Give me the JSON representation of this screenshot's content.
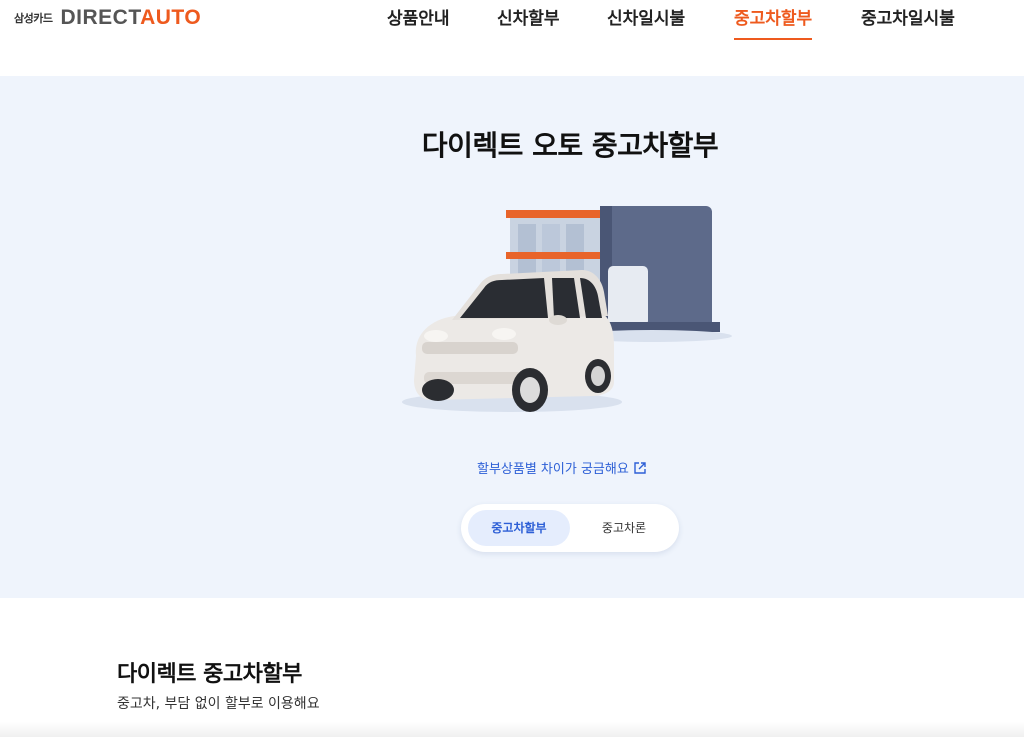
{
  "header": {
    "brand_small": "삼성카드",
    "brand_direct": "DIRECT",
    "brand_auto": "AUTO",
    "nav": [
      {
        "label": "상품안내"
      },
      {
        "label": "신차할부"
      },
      {
        "label": "신차일시불"
      },
      {
        "label": "중고차할부",
        "active": true
      },
      {
        "label": "중고차일시불"
      }
    ]
  },
  "hero": {
    "title": "다이렉트 오토 중고차할부",
    "info_link": "할부상품별 차이가 궁금해요",
    "toggle": [
      {
        "label": "중고차할부",
        "active": true
      },
      {
        "label": "중고차론"
      }
    ]
  },
  "section": {
    "title": "다이렉트 중고차할부",
    "subtitle": "중고차, 부담 없이 할부로 이용해요"
  },
  "colors": {
    "accent": "#ee5a1e",
    "link": "#2d5fd6",
    "hero_bg": "#eff4fc"
  }
}
